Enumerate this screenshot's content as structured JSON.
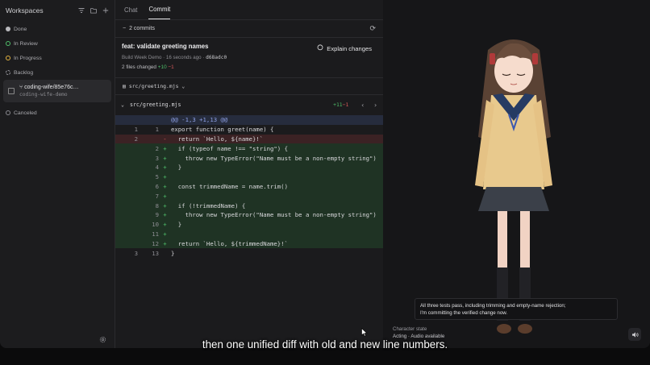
{
  "sidebar": {
    "title": "Workspaces",
    "groups": [
      {
        "label": "Done",
        "color": "#b9b9bd"
      },
      {
        "label": "In Review",
        "color": "#4fbf6a"
      },
      {
        "label": "In Progress",
        "color": "#e3b341"
      },
      {
        "label": "Backlog",
        "color": "#9a9aa0"
      }
    ],
    "workspace": {
      "branch": "coding-wife/85e76c…",
      "repo": "coding-wife-demo"
    },
    "canceled": {
      "label": "Canceled",
      "color": "#8a8a90"
    }
  },
  "tabs": [
    "Chat",
    "Commit"
  ],
  "active_tab": "Commit",
  "commits_label": "2 commits",
  "commit": {
    "title": "feat: validate greeting names",
    "project": "Build Week Demo",
    "time": "16 seconds ago",
    "sha": "d68adc0",
    "files_changed": "2 files changed",
    "additions": "+10",
    "deletions": "−1",
    "explain_label": "Explain changes"
  },
  "file_selector": "src/greeting.mjs",
  "file_header": {
    "name": "src/greeting.mjs",
    "additions": "+11",
    "deletions": "−1"
  },
  "diff": [
    {
      "type": "hunk",
      "old": "",
      "new": "",
      "sign": "",
      "code": "@@ -1,3 +1,13 @@"
    },
    {
      "type": "ctx",
      "old": "1",
      "new": "1",
      "sign": "",
      "code": "export function greet(name) {"
    },
    {
      "type": "rem",
      "old": "2",
      "new": "",
      "sign": "-",
      "code": "  return `Hello, ${name}!`"
    },
    {
      "type": "add",
      "old": "",
      "new": "2",
      "sign": "+",
      "code": "  if (typeof name !== \"string\") {"
    },
    {
      "type": "add",
      "old": "",
      "new": "3",
      "sign": "+",
      "code": "    throw new TypeError(\"Name must be a non-empty string\")"
    },
    {
      "type": "add",
      "old": "",
      "new": "4",
      "sign": "+",
      "code": "  }"
    },
    {
      "type": "add",
      "old": "",
      "new": "5",
      "sign": "+",
      "code": ""
    },
    {
      "type": "add",
      "old": "",
      "new": "6",
      "sign": "+",
      "code": "  const trimmedName = name.trim()"
    },
    {
      "type": "add",
      "old": "",
      "new": "7",
      "sign": "+",
      "code": ""
    },
    {
      "type": "add",
      "old": "",
      "new": "8",
      "sign": "+",
      "code": "  if (!trimmedName) {"
    },
    {
      "type": "add",
      "old": "",
      "new": "9",
      "sign": "+",
      "code": "    throw new TypeError(\"Name must be a non-empty string\")"
    },
    {
      "type": "add",
      "old": "",
      "new": "10",
      "sign": "+",
      "code": "  }"
    },
    {
      "type": "add",
      "old": "",
      "new": "11",
      "sign": "+",
      "code": ""
    },
    {
      "type": "add",
      "old": "",
      "new": "12",
      "sign": "+",
      "code": "  return `Hello, ${trimmedName}!`"
    },
    {
      "type": "ctx",
      "old": "3",
      "new": "13",
      "sign": "",
      "code": "}"
    }
  ],
  "speech": {
    "line1": "All three tests pass, including trimming and empty-name rejection;",
    "line2": "I'm committing the verified change now."
  },
  "character_state": {
    "label": "Character state",
    "value": "Acting · Audio available"
  },
  "caption": "then one unified diff with old and new line numbers."
}
